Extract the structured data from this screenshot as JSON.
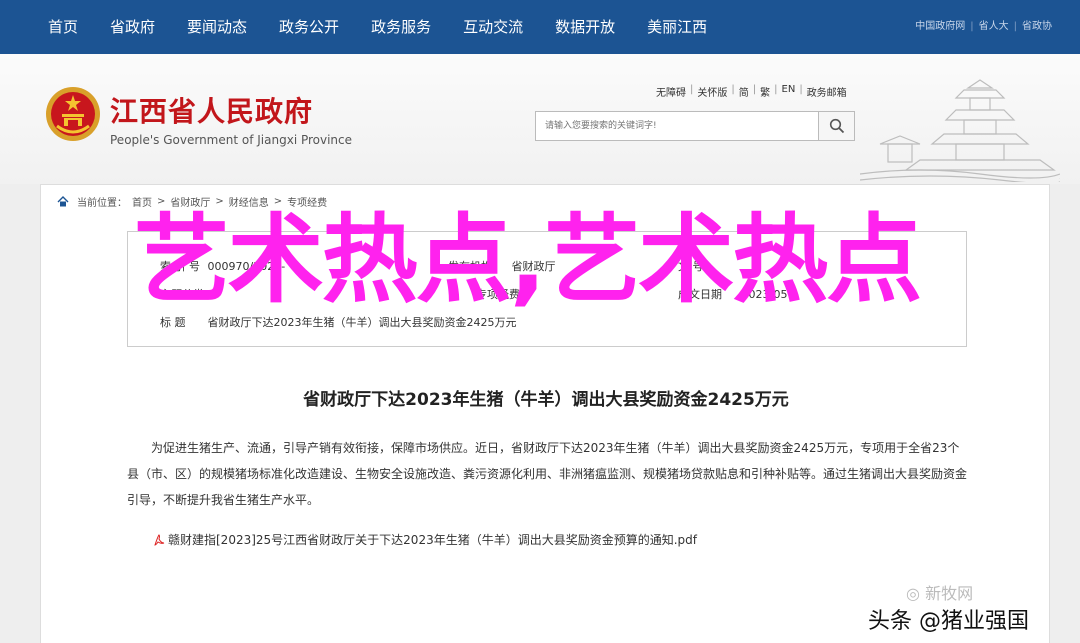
{
  "topnav": {
    "items": [
      "首页",
      "省政府",
      "要闻动态",
      "政务公开",
      "政务服务",
      "互动交流",
      "数据开放",
      "美丽江西"
    ],
    "right_links": [
      "中国政府网",
      "省人大",
      "省政协"
    ],
    "sep": "|"
  },
  "header": {
    "title": "江西省人民政府",
    "subtitle": "People's Government of Jiangxi Province",
    "tools": [
      "无障碍",
      "关怀版",
      "简",
      "繁",
      "EN",
      "政务邮箱"
    ],
    "search": {
      "placeholder": "请输入您要搜索的关键词字!"
    }
  },
  "breadcrumb": {
    "label": "当前位置：",
    "items": [
      "首页",
      "省财政厅",
      "财经信息",
      "专项经费"
    ],
    "sep": ">"
  },
  "meta": {
    "index_label": "索 引 号",
    "index_value": "000970/2023-",
    "publisher_label": "发布机构",
    "publisher_value": "省财政厅",
    "docno_label": "文 号",
    "subject_label": "主题分类",
    "subject_value": "专项经费",
    "date_label": "成文日期",
    "date_value": "2023-05",
    "title_label": "标 题",
    "title_value": "省财政厅下达2023年生猪（牛羊）调出大县奖励资金2425万元"
  },
  "doc": {
    "title": "省财政厅下达2023年生猪（牛羊）调出大县奖励资金2425万元",
    "body": "为促进生猪生产、流通，引导产销有效衔接，保障市场供应。近日，省财政厅下达2023年生猪（牛羊）调出大县奖励资金2425万元，专项用于全省23个县（市、区）的规模猪场标准化改造建设、生物安全设施改造、粪污资源化利用、非洲猪瘟监测、规模猪场贷款贴息和引种补贴等。通过生猪调出大县奖励资金引导，不断提升我省生猪生产水平。",
    "attachment": "赣财建指[2023]25号江西省财政厅关于下达2023年生猪（牛羊）调出大县奖励资金预算的通知.pdf"
  },
  "overlay": {
    "text": "艺术热点,艺术热点"
  },
  "watermark": {
    "text": "新牧网"
  },
  "credit": {
    "text": "头条 @猪业强国"
  },
  "colors": {
    "nav_bg": "#1c5493",
    "title_red": "#c2161b",
    "overlay_pink": "#ff22ee"
  }
}
